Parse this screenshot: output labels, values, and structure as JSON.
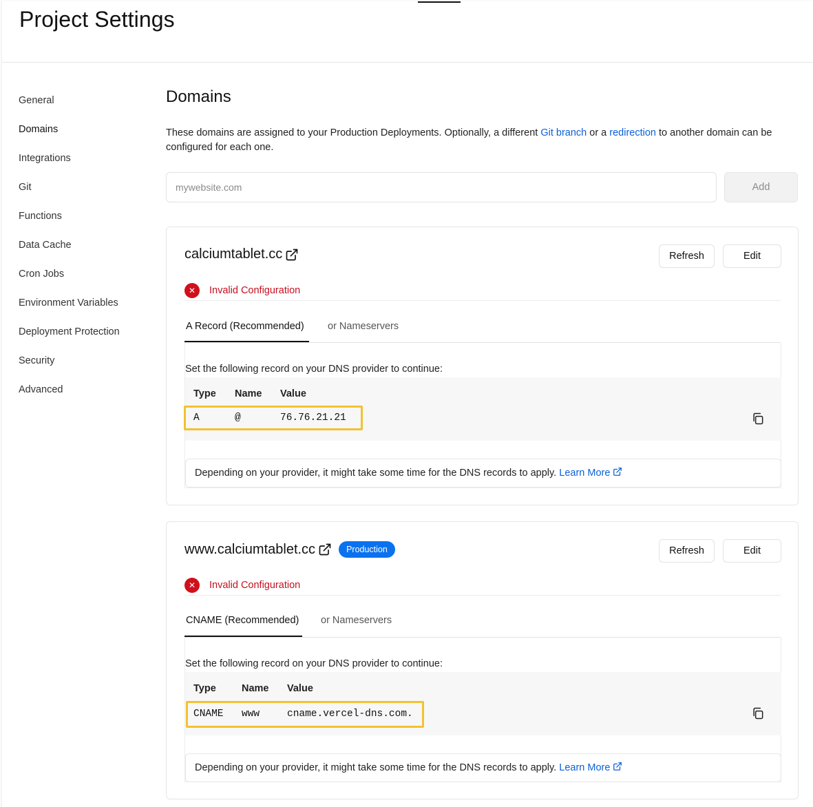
{
  "page": {
    "title": "Project Settings"
  },
  "sidebar": {
    "items": [
      {
        "label": "General"
      },
      {
        "label": "Domains",
        "active": true
      },
      {
        "label": "Integrations"
      },
      {
        "label": "Git"
      },
      {
        "label": "Functions"
      },
      {
        "label": "Data Cache"
      },
      {
        "label": "Cron Jobs"
      },
      {
        "label": "Environment Variables"
      },
      {
        "label": "Deployment Protection"
      },
      {
        "label": "Security"
      },
      {
        "label": "Advanced"
      }
    ]
  },
  "domains": {
    "title": "Domains",
    "description_part1": "These domains are assigned to your Production Deployments. Optionally, a different ",
    "git_branch_link": "Git branch",
    "description_part2": " or a ",
    "redirection_link": "redirection",
    "description_part3": " to another domain can be configured for each one.",
    "input_placeholder": "mywebsite.com",
    "input_value": "",
    "add_label": "Add"
  },
  "cards": [
    {
      "domain": "calciumtablet.cc",
      "badge": "",
      "refresh_label": "Refresh",
      "edit_label": "Edit",
      "status": "Invalid Configuration",
      "tab_active": "A Record (Recommended)",
      "tab_other": "or Nameservers",
      "instruction": "Set the following record on your DNS provider to continue:",
      "headers": {
        "type": "Type",
        "name": "Name",
        "value": "Value"
      },
      "record": {
        "type": "A",
        "name": "@",
        "value": "76.76.21.21"
      },
      "note": "Depending on your provider, it might take some time for the DNS records to apply. ",
      "learn_more": "Learn More"
    },
    {
      "domain": "www.calciumtablet.cc",
      "badge": "Production",
      "refresh_label": "Refresh",
      "edit_label": "Edit",
      "status": "Invalid Configuration",
      "tab_active": "CNAME (Recommended)",
      "tab_other": "or Nameservers",
      "instruction": "Set the following record on your DNS provider to continue:",
      "headers": {
        "type": "Type",
        "name": "Name",
        "value": "Value"
      },
      "record": {
        "type": "CNAME",
        "name": "www",
        "value": "cname.vercel-dns.com."
      },
      "note": "Depending on your provider, it might take some time for the DNS records to apply. ",
      "learn_more": "Learn More"
    }
  ],
  "colors": {
    "link": "#0a61d6",
    "error": "#d0101d",
    "badge": "#0a72ef",
    "highlight": "#f2c230"
  },
  "icons": {
    "external_link": "external-link-icon",
    "copy": "copy-icon",
    "error": "x-circle-icon"
  }
}
